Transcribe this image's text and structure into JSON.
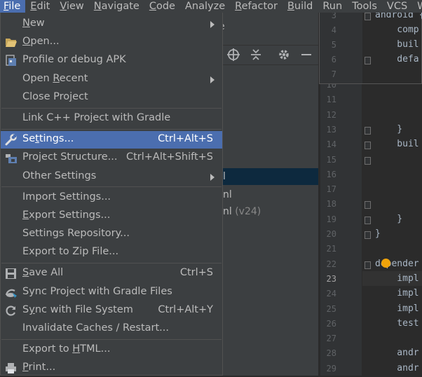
{
  "menubar": {
    "items": [
      {
        "label": "File",
        "mn": "F",
        "rest": "ile"
      },
      {
        "label": "Edit",
        "mn": "E",
        "rest": "dit"
      },
      {
        "label": "View",
        "mn": "V",
        "rest": "iew"
      },
      {
        "label": "Navigate",
        "mn": "N",
        "rest": "avigate"
      },
      {
        "label": "Code",
        "mn": "C",
        "rest": "ode"
      },
      {
        "label": "Analyze",
        "mn": "",
        "rest": "Analyze"
      },
      {
        "label": "Refactor",
        "mn": "R",
        "rest": "efactor"
      },
      {
        "label": "Build",
        "mn": "B",
        "rest": "uild"
      },
      {
        "label": "Run",
        "mn": "",
        "rest": "Run"
      },
      {
        "label": "Tools",
        "mn": "",
        "rest": "Tools"
      },
      {
        "label": "VCS",
        "mn": "",
        "rest": "VCS"
      },
      {
        "label": "W",
        "mn": "",
        "rest": "W"
      }
    ]
  },
  "file_menu": {
    "new": {
      "pre": "",
      "mn": "N",
      "post": "ew"
    },
    "open": {
      "pre": "",
      "mn": "O",
      "post": "pen..."
    },
    "profile_apk": {
      "pre": "Profile or debug APK",
      "mn": "",
      "post": ""
    },
    "open_recent": {
      "pre": "Open ",
      "mn": "R",
      "post": "ecent"
    },
    "close_project": {
      "pre": "Close Pro",
      "mn": "j",
      "post": "ect"
    },
    "link_cpp": {
      "pre": "Link C++ Project with Gradle",
      "mn": "",
      "post": ""
    },
    "settings": {
      "pre": "Se",
      "mn": "t",
      "post": "tings...",
      "shortcut": "Ctrl+Alt+S"
    },
    "project_structure": {
      "pre": "Project Structure...",
      "mn": "",
      "post": "",
      "shortcut": "Ctrl+Alt+Shift+S"
    },
    "other_settings": {
      "pre": "Other Settings",
      "mn": "",
      "post": ""
    },
    "import_settings": {
      "pre": "Import Settings...",
      "mn": "",
      "post": ""
    },
    "export_settings": {
      "pre": "",
      "mn": "E",
      "post": "xport Settings..."
    },
    "settings_repo": {
      "pre": "Settings Repository...",
      "mn": "",
      "post": ""
    },
    "export_zip": {
      "pre": "Export to Zip File...",
      "mn": "",
      "post": ""
    },
    "save_all": {
      "pre": "",
      "mn": "S",
      "post": "ave All",
      "shortcut": "Ctrl+S"
    },
    "sync_gradle": {
      "pre": "Sync Project with Gradle Files",
      "mn": "",
      "post": ""
    },
    "sync_fs": {
      "pre": "S",
      "mn": "y",
      "post": "nc with File System",
      "shortcut": "Ctrl+Alt+Y"
    },
    "invalidate": {
      "pre": "Invalidate Caches / Restart...",
      "mn": "",
      "post": ""
    },
    "export_html": {
      "pre": "Export to ",
      "mn": "H",
      "post": "TML..."
    },
    "print": {
      "pre": "",
      "mn": "P",
      "post": "rint..."
    }
  },
  "project_pane": {
    "tab_suffix": "e",
    "rows": [
      {
        "text": "l",
        "dim": ""
      },
      {
        "text": "nl",
        "dim": ""
      },
      {
        "text": "nl",
        "dim": " (v24)"
      }
    ]
  },
  "editor": {
    "popup_lines": [
      {
        "n": "3",
        "code": "android {"
      },
      {
        "n": "4",
        "code": "    comp"
      },
      {
        "n": "5",
        "code": "    buil"
      },
      {
        "n": "6",
        "code": "    defa"
      },
      {
        "n": "7",
        "code": ""
      }
    ],
    "lines": [
      {
        "n": "10",
        "code": ""
      },
      {
        "n": "11",
        "code": ""
      },
      {
        "n": "12",
        "code": ""
      },
      {
        "n": "13",
        "code": "    }"
      },
      {
        "n": "14",
        "code": "    buil"
      },
      {
        "n": "15",
        "code": ""
      },
      {
        "n": "16",
        "code": ""
      },
      {
        "n": "17",
        "code": ""
      },
      {
        "n": "18",
        "code": ""
      },
      {
        "n": "19",
        "code": "    }"
      },
      {
        "n": "20",
        "code": "}"
      },
      {
        "n": "21",
        "code": ""
      },
      {
        "n": "22",
        "code": "depender"
      },
      {
        "n": "23",
        "code": "    impl"
      },
      {
        "n": "24",
        "code": "    impl"
      },
      {
        "n": "25",
        "code": "    impl"
      },
      {
        "n": "26",
        "code": "    test"
      },
      {
        "n": "27",
        "code": ""
      },
      {
        "n": "28",
        "code": "    andr"
      },
      {
        "n": "29",
        "code": "    andr"
      }
    ]
  },
  "colors": {
    "accent": "#4b6eaf",
    "menu_bg": "#3c3f41",
    "editor_bg": "#2b2b2b",
    "bulb": "#f0a30a"
  }
}
